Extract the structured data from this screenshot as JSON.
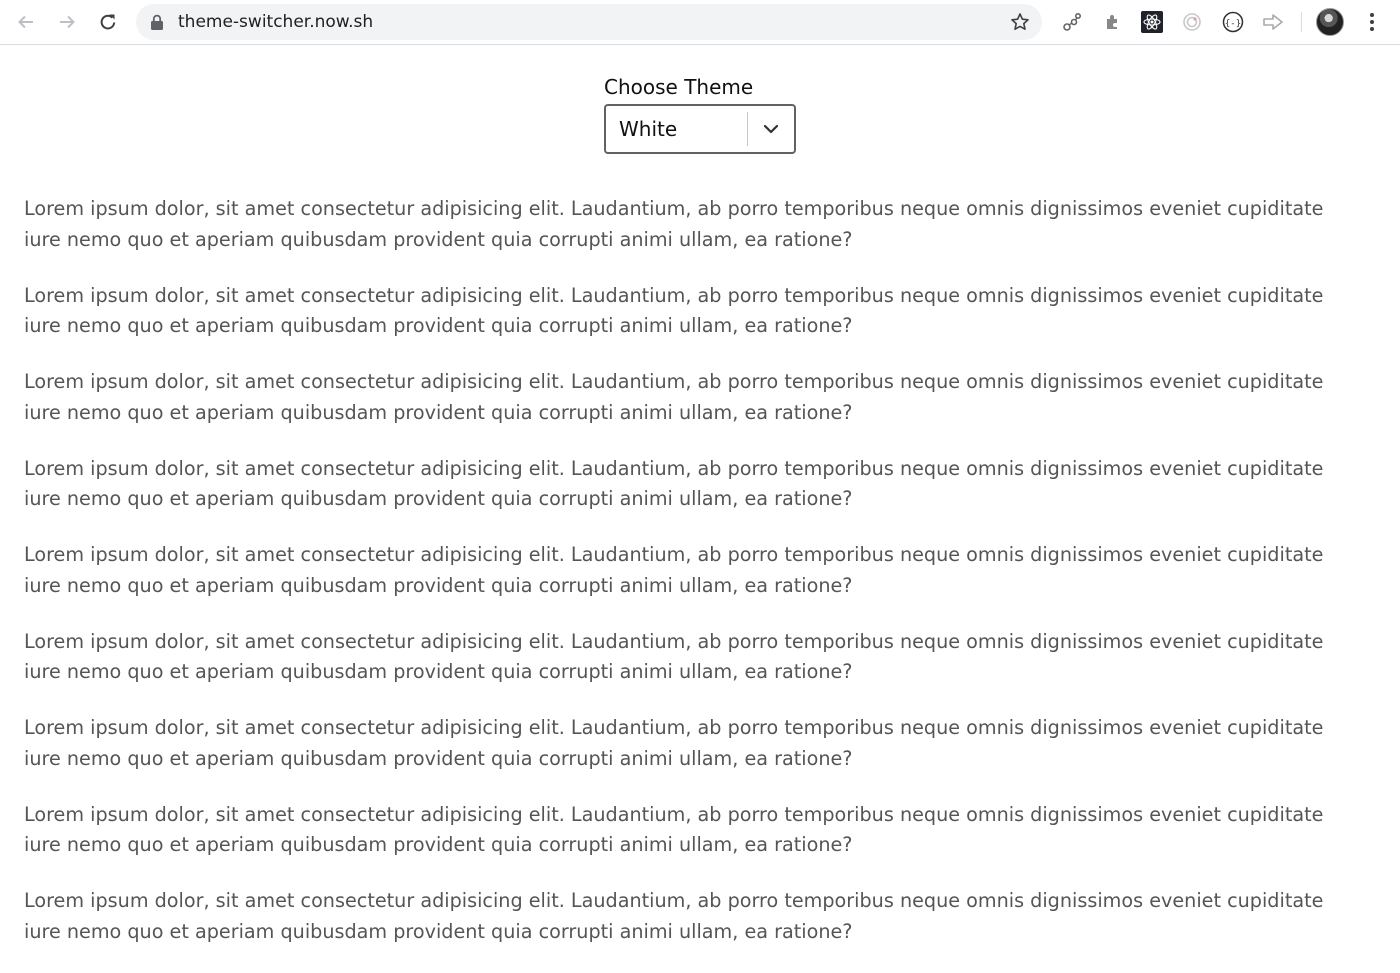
{
  "browser": {
    "url": "theme-switcher.now.sh"
  },
  "theme_switcher": {
    "label": "Choose Theme",
    "selected": "White"
  },
  "content": {
    "paragraphs": [
      "Lorem ipsum dolor, sit amet consectetur adipisicing elit. Laudantium, ab porro temporibus neque omnis dignissimos eveniet cupiditate iure nemo quo et aperiam quibusdam provident quia corrupti animi ullam, ea ratione?",
      "Lorem ipsum dolor, sit amet consectetur adipisicing elit. Laudantium, ab porro temporibus neque omnis dignissimos eveniet cupiditate iure nemo quo et aperiam quibusdam provident quia corrupti animi ullam, ea ratione?",
      "Lorem ipsum dolor, sit amet consectetur adipisicing elit. Laudantium, ab porro temporibus neque omnis dignissimos eveniet cupiditate iure nemo quo et aperiam quibusdam provident quia corrupti animi ullam, ea ratione?",
      "Lorem ipsum dolor, sit amet consectetur adipisicing elit. Laudantium, ab porro temporibus neque omnis dignissimos eveniet cupiditate iure nemo quo et aperiam quibusdam provident quia corrupti animi ullam, ea ratione?",
      "Lorem ipsum dolor, sit amet consectetur adipisicing elit. Laudantium, ab porro temporibus neque omnis dignissimos eveniet cupiditate iure nemo quo et aperiam quibusdam provident quia corrupti animi ullam, ea ratione?",
      "Lorem ipsum dolor, sit amet consectetur adipisicing elit. Laudantium, ab porro temporibus neque omnis dignissimos eveniet cupiditate iure nemo quo et aperiam quibusdam provident quia corrupti animi ullam, ea ratione?",
      "Lorem ipsum dolor, sit amet consectetur adipisicing elit. Laudantium, ab porro temporibus neque omnis dignissimos eveniet cupiditate iure nemo quo et aperiam quibusdam provident quia corrupti animi ullam, ea ratione?",
      "Lorem ipsum dolor, sit amet consectetur adipisicing elit. Laudantium, ab porro temporibus neque omnis dignissimos eveniet cupiditate iure nemo quo et aperiam quibusdam provident quia corrupti animi ullam, ea ratione?",
      "Lorem ipsum dolor, sit amet consectetur adipisicing elit. Laudantium, ab porro temporibus neque omnis dignissimos eveniet cupiditate iure nemo quo et aperiam quibusdam provident quia corrupti animi ullam, ea ratione?"
    ]
  },
  "icons": {
    "back": "arrow-left-icon",
    "forward": "arrow-right-icon",
    "reload": "reload-icon",
    "lock": "lock-icon",
    "bookmark": "star-icon",
    "extensions": [
      "graph-extension-icon",
      "puzzle-extension-icon",
      "react-devtools-icon",
      "target-extension-icon",
      "braces-extension-icon",
      "forward-extension-icon"
    ],
    "profile": "avatar",
    "menu": "kebab-menu-icon",
    "select_chevron": "chevron-down-icon"
  },
  "colors": {
    "page_background": "#ffffff",
    "body_text": "#555555",
    "label_text": "#111111",
    "select_border": "#5f6368",
    "omnibox_background": "#f1f3f4"
  }
}
